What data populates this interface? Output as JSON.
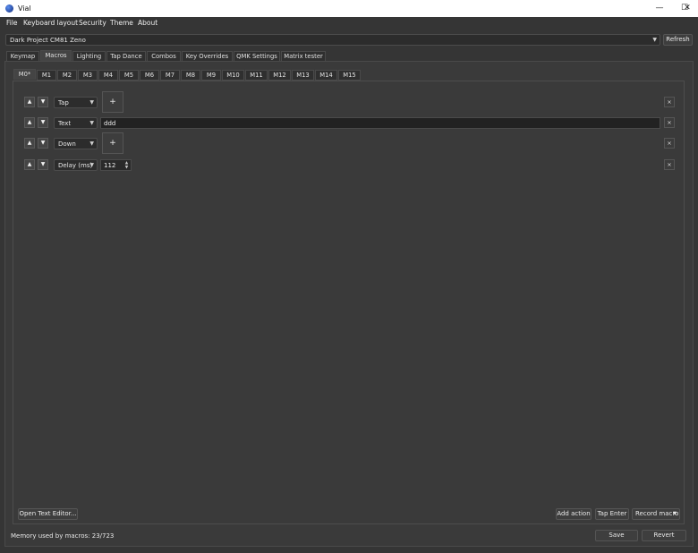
{
  "window": {
    "title": "Vial",
    "minimize_glyph": "—",
    "maximize_glyph": "☐",
    "close_glyph": "✕"
  },
  "menu": [
    "File",
    "Keyboard layout",
    "Security",
    "Theme",
    "About"
  ],
  "device": {
    "selected": "Dark Project CM81 Zeno",
    "refresh_label": "Refresh"
  },
  "main_tabs": [
    "Keymap",
    "Macros",
    "Lighting",
    "Tap Dance",
    "Combos",
    "Key Overrides",
    "QMK Settings",
    "Matrix tester"
  ],
  "active_main_tab": "Macros",
  "macro_tabs": [
    "M0*",
    "M1",
    "M2",
    "M3",
    "M4",
    "M5",
    "M6",
    "M7",
    "M8",
    "M9",
    "M10",
    "M11",
    "M12",
    "M13",
    "M14",
    "M15"
  ],
  "active_macro_tab": "M0*",
  "actions": [
    {
      "type": "Tap",
      "kind": "keys"
    },
    {
      "type": "Text",
      "kind": "text",
      "value": "ddd"
    },
    {
      "type": "Down",
      "kind": "keys"
    },
    {
      "type": "Delay (ms)",
      "kind": "delay",
      "value": "112"
    }
  ],
  "glyphs": {
    "up": "▲",
    "down": "▼",
    "dropdown": "▼",
    "plus": "+",
    "remove": "×"
  },
  "footer": {
    "open_text_editor": "Open Text Editor...",
    "add_action": "Add action",
    "tap_enter": "Tap Enter",
    "record_macro": "Record macro",
    "memory": "Memory used by macros: 23/723",
    "save": "Save",
    "revert": "Revert"
  },
  "colors": {
    "background": "#353535",
    "panel": "#3a3a3a",
    "text_field": "#222222"
  },
  "icons": {
    "app": "vial-logo-icon",
    "up": "arrow-up-icon",
    "down": "arrow-down-icon",
    "remove": "close-icon",
    "dropdown": "chevron-down-icon"
  }
}
